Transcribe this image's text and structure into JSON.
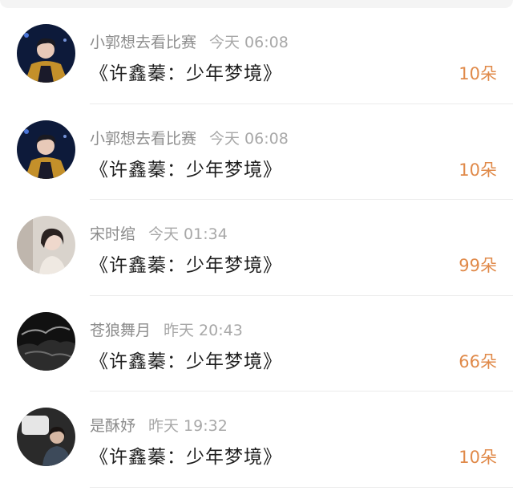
{
  "comments": [
    {
      "user": "小郭想去看比赛",
      "time": "今天 06:08",
      "title": "《许鑫蓁：少年梦境》",
      "count": "10朵",
      "avatar_icon": "avatar-stage-performer"
    },
    {
      "user": "小郭想去看比赛",
      "time": "今天 06:08",
      "title": "《许鑫蓁：少年梦境》",
      "count": "10朵",
      "avatar_icon": "avatar-stage-performer"
    },
    {
      "user": "宋时绾",
      "time": "今天 01:34",
      "title": "《许鑫蓁：少年梦境》",
      "count": "99朵",
      "avatar_icon": "avatar-woman-portrait"
    },
    {
      "user": "苍狼舞月",
      "time": "昨天 20:43",
      "title": "《许鑫蓁：少年梦境》",
      "count": "66朵",
      "avatar_icon": "avatar-dark-landscape"
    },
    {
      "user": "是酥妤",
      "time": "昨天 19:32",
      "title": "《许鑫蓁：少年梦境》",
      "count": "10朵",
      "avatar_icon": "avatar-person-window"
    }
  ],
  "colors": {
    "count": "#e08a4a",
    "username": "#8c8c8c",
    "title": "#1e1e1e",
    "divider": "#ececec"
  }
}
